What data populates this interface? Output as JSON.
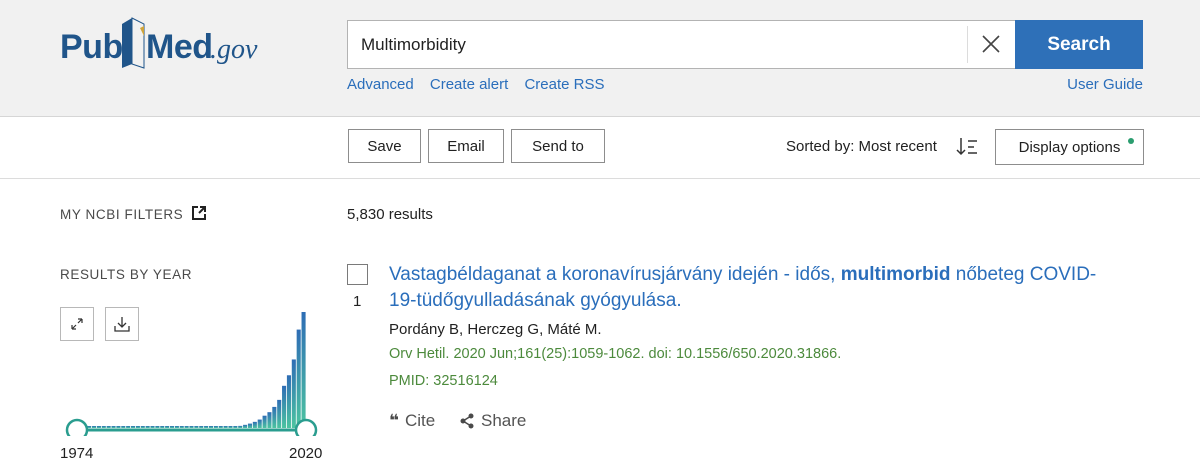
{
  "header": {
    "logo": {
      "pub": "Pub",
      "med": "Med",
      "gov": ".gov"
    },
    "search": {
      "value": "Multimorbidity",
      "button_label": "Search"
    },
    "links": [
      "Advanced",
      "Create alert",
      "Create RSS"
    ],
    "user_guide": "User Guide"
  },
  "toolbar": {
    "save_label": "Save",
    "email_label": "Email",
    "send_to_label": "Send to",
    "sorted_label": "Sorted by: Most recent",
    "display_options_label": "Display options"
  },
  "sidebar": {
    "my_ncbi_filters": "MY NCBI FILTERS",
    "results_by_year": "RESULTS BY YEAR",
    "year_start": "1974",
    "year_end": "2020",
    "histogram_counts": [
      1,
      1,
      1,
      1,
      1,
      1,
      1,
      1,
      1,
      1,
      1,
      1,
      1,
      1,
      1,
      1,
      1,
      1,
      1,
      1,
      1,
      1,
      1,
      1,
      1,
      1,
      1,
      2,
      2,
      3,
      4,
      6,
      9,
      12,
      18,
      25,
      35,
      48,
      70,
      90,
      120,
      160,
      240,
      300,
      390,
      560,
      660
    ],
    "colors": {
      "accent": "#2a9d8f",
      "bar_top": "#2e6db5",
      "bar_bottom": "#4cc4a1"
    }
  },
  "results": {
    "count": "5,830 results",
    "items": [
      {
        "number": "1",
        "title_before": "Vastagbéldaganat a koronavírusjárvány idején - idős, ",
        "title_bold": "multimorbid",
        "title_after": " nőbeteg COVID-19-tüdőgyulladásának gyógyulása.",
        "authors": "Pordány B, Herczeg G, Máté M.",
        "citation": "Orv Hetil. 2020 Jun;161(25):1059-1062. doi: 10.1556/650.2020.31866.",
        "pmid": "PMID: 32516124",
        "cite_label": "Cite",
        "share_label": "Share"
      }
    ]
  },
  "colors": {
    "link": "#2a6ebb",
    "search_button": "#2e70b8",
    "citation": "#4c8a3c",
    "header_bg": "#f1f1f1"
  }
}
